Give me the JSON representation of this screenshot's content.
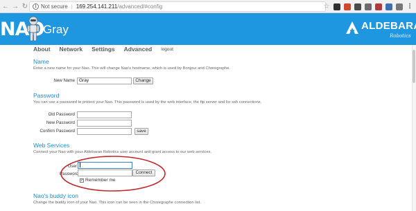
{
  "browser": {
    "back_icon": "back-arrow-icon",
    "forward_icon": "forward-arrow-icon",
    "reload_icon": "reload-icon",
    "security_label": "Not secure",
    "url_host": "169.254.141.211",
    "url_path": "/advanced/#config",
    "extensions": [
      {
        "name": "star-icon",
        "color": "#9a9a9a"
      },
      {
        "name": "extension-a-icon",
        "color": "#2f2f2f"
      },
      {
        "name": "extension-b-icon",
        "color": "#d0462f"
      },
      {
        "name": "extension-c-icon",
        "color": "#4a4a4a"
      },
      {
        "name": "extension-d-icon",
        "color": "#6c6c6c"
      },
      {
        "name": "extension-e-icon",
        "color": "#b33a3a"
      },
      {
        "name": "extension-f-icon",
        "color": "#3d6fb6"
      },
      {
        "name": "extension-g-icon",
        "color": "#777777"
      },
      {
        "name": "menu-dots-icon",
        "color": "#777777"
      }
    ]
  },
  "header": {
    "logo_text": "NAO",
    "robot_name": "Gray",
    "brand_name": "ALDEBARAN",
    "brand_sub": "Robotics",
    "background": "#1e96e0"
  },
  "nav": {
    "items": [
      "About",
      "Network",
      "Settings",
      "Advanced"
    ],
    "logout": "logout"
  },
  "name_section": {
    "title": "Name",
    "desc": "Enter a new name for your Nao. This will change Nao's hostname, which is used by Bonjour and Choregraphe.",
    "label": "New Name",
    "value": "Gray",
    "button": "Change"
  },
  "password_section": {
    "title": "Password",
    "desc": "You can use a password to protect your Nao. This password is used by the web interface, the ftp server and for ssh connections.",
    "old_label": "Old Password",
    "new_label": "New Password",
    "confirm_label": "Confirm Password",
    "button": "save"
  },
  "webservices_section": {
    "title": "Web Services",
    "desc": "Connect your Nao with your Aldebaran Robotics user account and grant access to our web services.",
    "user_label": "User",
    "password_label": "Password",
    "button": "Connect",
    "remember_label": "Remember me",
    "remember_checked": true,
    "annotation_color": "#c0272d"
  },
  "buddy_section": {
    "title": "Nao's buddy icon",
    "desc": "Change the buddy icon of your Nao. This icon can be seen in the Choregraphe connection list."
  }
}
